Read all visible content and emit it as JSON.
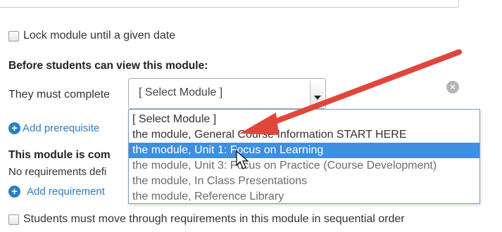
{
  "lock": {
    "label": "Lock module until a given date",
    "checked": false
  },
  "prereq": {
    "heading": "Before students can view this module:",
    "label": "They must complete",
    "select_value": "[ Select Module ]",
    "add_link": "Add prerequisite",
    "options": [
      "[ Select Module ]",
      "the module, General Course Information START HERE",
      "the module, Unit 1: Focus on Learning",
      "the module, Unit 3: Focus on Practice (Course Development)",
      "the module, In Class Presentations",
      "the module, Reference Library"
    ],
    "highlighted_option": "the module, Unit 1: Focus on Learning"
  },
  "completion": {
    "heading": "This module is com",
    "text": "No requirements defi",
    "add_link": "Add requirement"
  },
  "sequential": {
    "label": "Students must move through requirements in this module in sequential order",
    "checked": false
  },
  "colors": {
    "link": "#2a7ec1",
    "highlight": "#3d8fe0",
    "annotation_arrow": "#e0473c"
  },
  "icons": {
    "plus": "plus-circle-icon",
    "remove": "remove-circle-icon",
    "cursor": "mouse-pointer-icon"
  }
}
